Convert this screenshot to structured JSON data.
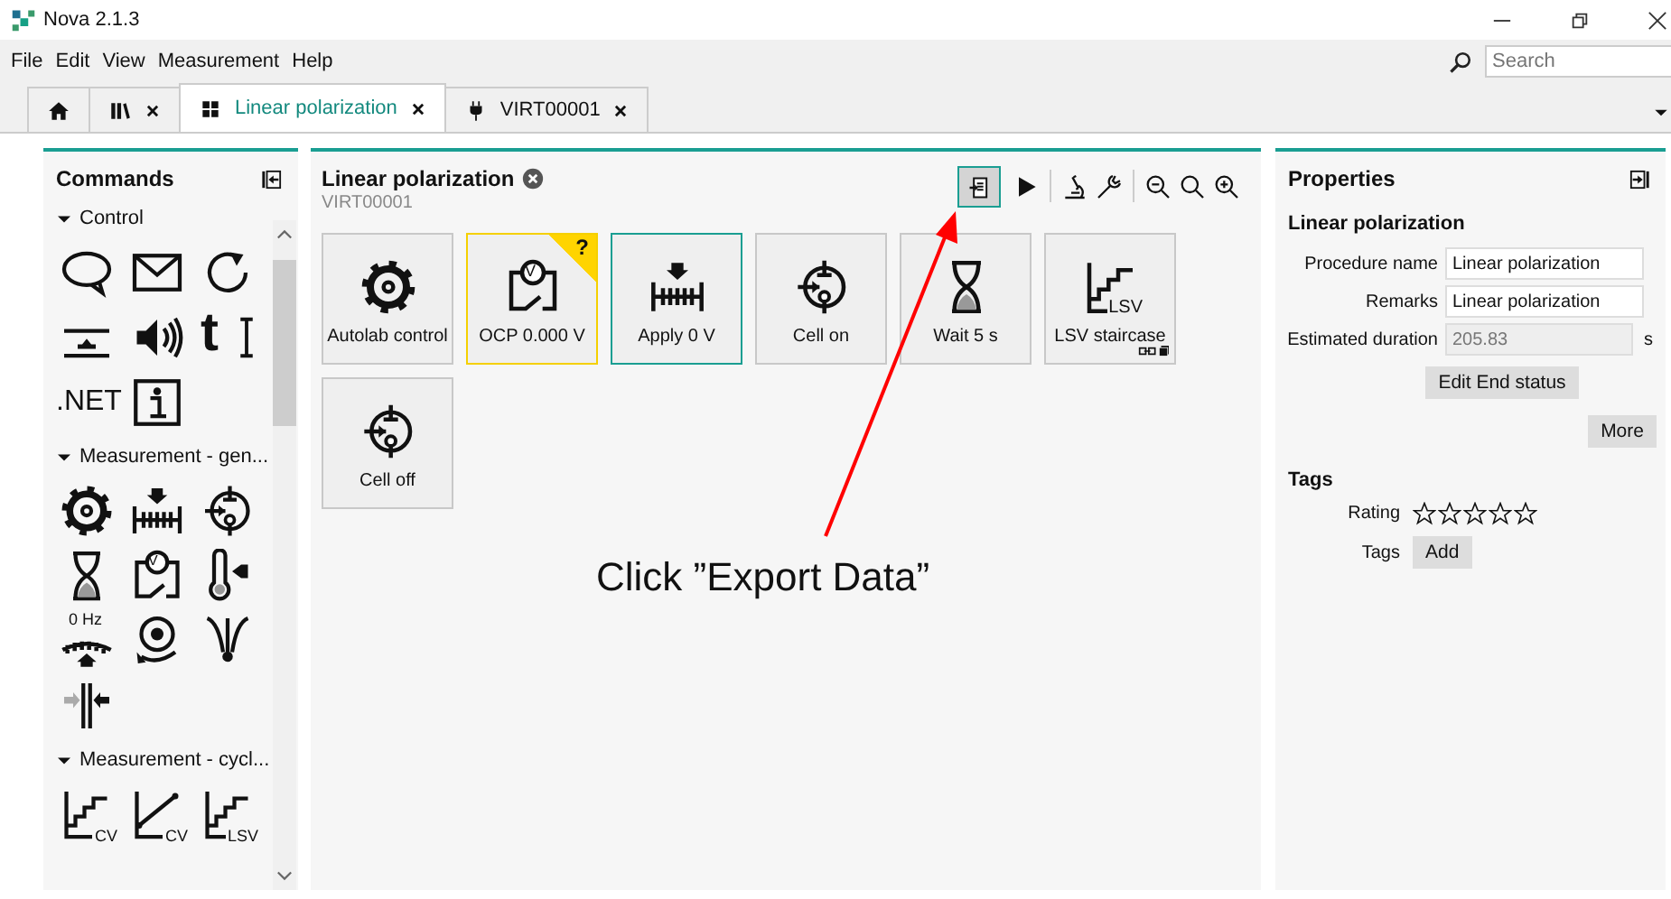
{
  "window": {
    "title": "Nova 2.1.3"
  },
  "menu": [
    "File",
    "Edit",
    "View",
    "Measurement",
    "Help"
  ],
  "search": {
    "placeholder": "Search"
  },
  "tabs": [
    {
      "kind": "home",
      "selected": false,
      "closable": false
    },
    {
      "kind": "library",
      "selected": false,
      "closable": true
    },
    {
      "kind": "procedure",
      "label": "Linear polarization",
      "selected": true,
      "closable": true
    },
    {
      "kind": "instrument",
      "label": "VIRT00001",
      "selected": false,
      "closable": true
    }
  ],
  "commands": {
    "title": "Commands",
    "groups": [
      {
        "title": "Control",
        "expanded": true,
        "items": [
          {
            "kind": "comment"
          },
          {
            "kind": "message"
          },
          {
            "kind": "repeat"
          },
          {
            "kind": "level"
          },
          {
            "kind": "sound"
          },
          {
            "kind": "text",
            "label": "t"
          },
          {
            "kind": "dotnet",
            "label": ".NET"
          },
          {
            "kind": "info"
          }
        ]
      },
      {
        "title": "Measurement - gen...",
        "expanded": true,
        "items": [
          {
            "kind": "gear"
          },
          {
            "kind": "apply"
          },
          {
            "kind": "cell"
          },
          {
            "kind": "wait"
          },
          {
            "kind": "ocp",
            "label": "V"
          },
          {
            "kind": "temperature"
          },
          {
            "kind": "frequency",
            "label": "0 Hz"
          },
          {
            "kind": "rotation"
          },
          {
            "kind": "electrode"
          },
          {
            "kind": "stirrer"
          }
        ]
      },
      {
        "title": "Measurement - cycl...",
        "expanded": true,
        "items": [
          {
            "kind": "stair",
            "label": "CV"
          },
          {
            "kind": "ramp",
            "label": "CV"
          },
          {
            "kind": "stair",
            "label": "LSV"
          }
        ]
      }
    ]
  },
  "procedure": {
    "title": "Linear polarization",
    "subtitle": "VIRT00001",
    "toolbar": [
      {
        "kind": "export",
        "selected": true
      },
      {
        "kind": "play",
        "selected": false
      },
      {
        "kind": "divider"
      },
      {
        "kind": "microscope",
        "selected": false
      },
      {
        "kind": "wrench",
        "selected": false
      },
      {
        "kind": "divider"
      },
      {
        "kind": "zoom-out",
        "selected": false
      },
      {
        "kind": "zoom-reset",
        "selected": false
      },
      {
        "kind": "zoom-in",
        "selected": false
      }
    ],
    "tiles": [
      {
        "kind": "gear",
        "label": "Autolab control",
        "selected": false,
        "warning": false,
        "linked": false
      },
      {
        "kind": "ocp",
        "icon_label": "V",
        "label": "OCP 0.000 V",
        "selected": false,
        "warning": true,
        "badge": "?",
        "linked": false
      },
      {
        "kind": "apply",
        "label": "Apply 0 V",
        "selected": true,
        "warning": false,
        "linked": false
      },
      {
        "kind": "cell",
        "label": "Cell on",
        "selected": false,
        "warning": false,
        "linked": false
      },
      {
        "kind": "wait",
        "label": "Wait 5 s",
        "selected": false,
        "warning": false,
        "linked": false
      },
      {
        "kind": "stair",
        "icon_label": "LSV",
        "label": "LSV staircase",
        "selected": false,
        "warning": false,
        "linked": true
      },
      {
        "kind": "cell",
        "label": "Cell off",
        "selected": false,
        "warning": false,
        "linked": false
      }
    ]
  },
  "properties": {
    "title": "Properties",
    "subtitle": "Linear polarization",
    "fields": [
      {
        "label": "Procedure name",
        "value": "Linear polarization",
        "disabled": false
      },
      {
        "label": "Remarks",
        "value": "Linear polarization",
        "disabled": false
      },
      {
        "label": "Estimated duration",
        "value": "205.83",
        "disabled": true,
        "unit": "s"
      }
    ],
    "end_status_button": "Edit End status",
    "more_button": "More",
    "tags": {
      "title": "Tags",
      "rating_label": "Rating",
      "stars": 0,
      "tags_label": "Tags",
      "add_button": "Add"
    }
  },
  "annotation": {
    "text": "Click ”Export Data”"
  }
}
